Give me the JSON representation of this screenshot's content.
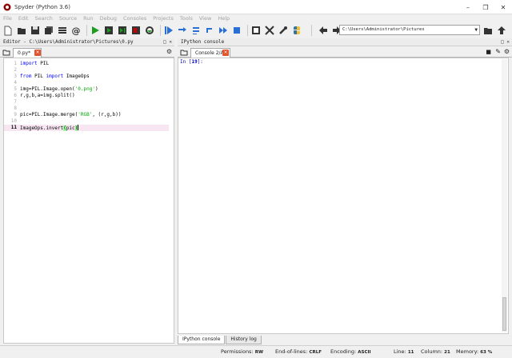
{
  "window": {
    "title": "Spyder (Python 3.6)"
  },
  "menu": [
    "File",
    "Edit",
    "Search",
    "Source",
    "Run",
    "Debug",
    "Consoles",
    "Projects",
    "Tools",
    "View",
    "Help"
  ],
  "toolbar": {
    "path": "C:\\Users\\Administrator\\Pictures",
    "icons": [
      "new-file-icon",
      "open-file-icon",
      "save-icon",
      "save-all-icon",
      "list-icon",
      "at-icon",
      "run-icon",
      "run-cell-icon",
      "run-cell-advance-icon",
      "run-selection-icon",
      "rerun-icon",
      "debug-icon",
      "step-icon",
      "step-into-icon",
      "step-return-icon",
      "continue-icon",
      "stop-icon",
      "maximize-pane-icon",
      "fullscreen-icon",
      "wrench-icon",
      "python-icon",
      "back-icon",
      "forward-icon",
      "browse-folder-icon",
      "up-icon"
    ]
  },
  "editor": {
    "title": "Editor - C:\\Users\\Administrator\\Pictures\\0.py",
    "tab": "0.py*",
    "lines": [
      {
        "n": "1",
        "code": "import PIL"
      },
      {
        "n": "2",
        "code": ""
      },
      {
        "n": "3",
        "code": "from PIL import ImageOps"
      },
      {
        "n": "4",
        "code": ""
      },
      {
        "n": "5",
        "code": "img=PIL.Image.open('0.png')"
      },
      {
        "n": "6",
        "code": "r,g,b,a=img.split()"
      },
      {
        "n": "7",
        "code": ""
      },
      {
        "n": "8",
        "code": ""
      },
      {
        "n": "9",
        "code": "pic=PIL.Image.merge('RGB', (r,g,b))"
      },
      {
        "n": "10",
        "code": ""
      },
      {
        "n": "11",
        "code": "ImageOps.invert(pic)"
      }
    ]
  },
  "console": {
    "title": "IPython console",
    "tab": "Console 2/A",
    "prompt_prefix": "In [",
    "prompt_num": "19",
    "prompt_suffix": "]:"
  },
  "bottom_tabs": [
    "IPython console",
    "History log"
  ],
  "status": {
    "permissions_label": "Permissions:",
    "permissions": "RW",
    "eol_label": "End-of-lines:",
    "eol": "CRLF",
    "encoding_label": "Encoding:",
    "encoding": "ASCII",
    "line_label": "Line:",
    "line": "11",
    "column_label": "Column:",
    "column": "21",
    "memory_label": "Memory:",
    "memory": "63 %"
  },
  "colors": {
    "keyword": "#0000ff",
    "string": "#00aa00",
    "active_line": "#f7e6f2",
    "run_green": "#1e9e1e",
    "debug_blue": "#2a6fd6",
    "close_tab": "#e0552e"
  }
}
